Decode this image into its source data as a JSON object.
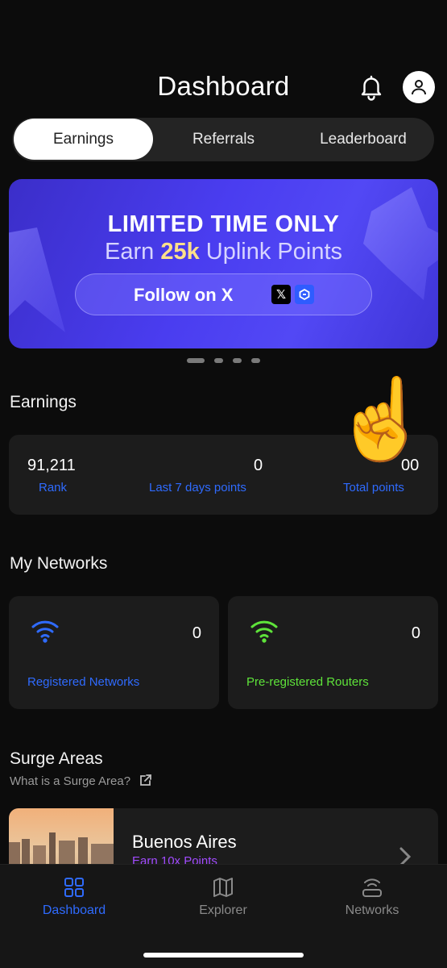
{
  "header": {
    "title": "Dashboard"
  },
  "tabs": [
    {
      "label": "Earnings",
      "active": true
    },
    {
      "label": "Referrals",
      "active": false
    },
    {
      "label": "Leaderboard",
      "active": false
    }
  ],
  "banner": {
    "line1": "LIMITED TIME ONLY",
    "line2_prefix": "Earn",
    "line2_highlight": "25k",
    "line2_suffix": "Uplink Points",
    "button_label": "Follow on X",
    "icons": [
      "x-logo-icon",
      "chain-link-icon"
    ],
    "page_count": 4,
    "active_page": 1
  },
  "earnings": {
    "section_title": "Earnings",
    "stats": [
      {
        "value": "91,211",
        "label": "Rank"
      },
      {
        "value": "0",
        "label": "Last 7 days points"
      },
      {
        "value": "00",
        "label": "Total points"
      }
    ]
  },
  "overlay": {
    "emoji": "☝️"
  },
  "networks": {
    "section_title": "My Networks",
    "cards": [
      {
        "value": "0",
        "label": "Registered Networks",
        "color": "#2f6bff",
        "icon": "wifi-icon"
      },
      {
        "value": "0",
        "label": "Pre-registered Routers",
        "color": "#5ee33a",
        "icon": "wifi-icon"
      }
    ]
  },
  "surge": {
    "section_title": "Surge Areas",
    "subtitle": "What is a Surge Area?",
    "items": [
      {
        "city": "Buenos Aires",
        "subtitle": "Earn 10x Points"
      }
    ]
  },
  "nav": [
    {
      "label": "Dashboard",
      "icon": "grid-icon",
      "active": true
    },
    {
      "label": "Explorer",
      "icon": "map-icon",
      "active": false
    },
    {
      "label": "Networks",
      "icon": "router-icon",
      "active": false
    }
  ],
  "colors": {
    "accent": "#2f6bff",
    "green": "#5ee33a",
    "purple": "#a24bff",
    "banner": "#4a3df0"
  }
}
